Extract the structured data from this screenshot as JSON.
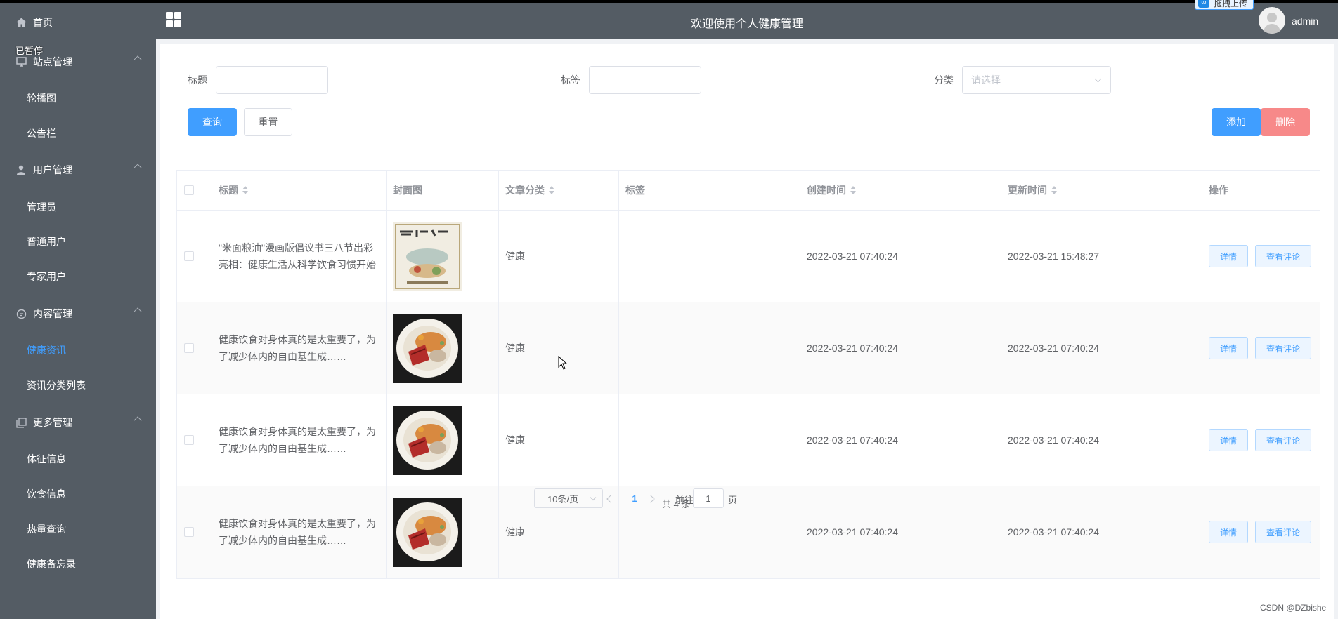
{
  "header": {
    "title": "欢迎使用个人健康管理",
    "username": "admin",
    "upload_badge": "拖拽上传"
  },
  "overlay": {
    "paused_text": "已暂停"
  },
  "sidebar": {
    "home": "首页",
    "groups": [
      {
        "label": "站点管理",
        "icon": "monitor-icon",
        "items": [
          "轮播图",
          "公告栏"
        ]
      },
      {
        "label": "用户管理",
        "icon": "user-icon",
        "items": [
          "管理员",
          "普通用户",
          "专家用户"
        ]
      },
      {
        "label": "内容管理",
        "icon": "chat-icon",
        "items": [
          "健康资讯",
          "资讯分类列表"
        ]
      },
      {
        "label": "更多管理",
        "icon": "copy-icon",
        "items": [
          "体征信息",
          "饮食信息",
          "热量查询",
          "健康备忘录"
        ]
      }
    ],
    "active_item": "健康资讯"
  },
  "search": {
    "title_label": "标题",
    "title_value": "",
    "tag_label": "标签",
    "tag_value": "",
    "category_label": "分类",
    "category_placeholder": "请选择",
    "query_button": "查询",
    "reset_button": "重置",
    "add_button": "添加",
    "delete_button": "删除"
  },
  "table": {
    "columns": [
      "标题",
      "封面图",
      "文章分类",
      "标签",
      "创建时间",
      "更新时间",
      "操作"
    ],
    "rows": [
      {
        "title": "\"米面粮油\"漫画版倡议书三八节出彩亮相：健康生活从科学饮食习惯开始",
        "cover": "poster",
        "category": "健康",
        "tags": "",
        "created": "2022-03-21 07:40:24",
        "updated": "2022-03-21 15:48:27"
      },
      {
        "title": "健康饮食对身体真的是太重要了，为了减少体内的自由基生成……",
        "cover": "food",
        "category": "健康",
        "tags": "",
        "created": "2022-03-21 07:40:24",
        "updated": "2022-03-21 07:40:24"
      },
      {
        "title": "健康饮食对身体真的是太重要了，为了减少体内的自由基生成……",
        "cover": "food",
        "category": "健康",
        "tags": "",
        "created": "2022-03-21 07:40:24",
        "updated": "2022-03-21 07:40:24"
      },
      {
        "title": "健康饮食对身体真的是太重要了，为了减少体内的自由基生成……",
        "cover": "food",
        "category": "健康",
        "tags": "",
        "created": "2022-03-21 07:40:24",
        "updated": "2022-03-21 07:40:24"
      }
    ],
    "detail_button": "详情",
    "comments_button": "查看评论"
  },
  "pagination": {
    "total_text": "共 4 条",
    "page_size": "10条/页",
    "current_page": "1",
    "goto_prefix": "前往",
    "goto_value": "1",
    "goto_suffix": "页"
  },
  "watermark": "CSDN @DZbishe",
  "colors": {
    "sidebar_bg": "#545c64",
    "primary": "#409eff",
    "danger": "#f78989",
    "active_menu": "#409eff"
  }
}
